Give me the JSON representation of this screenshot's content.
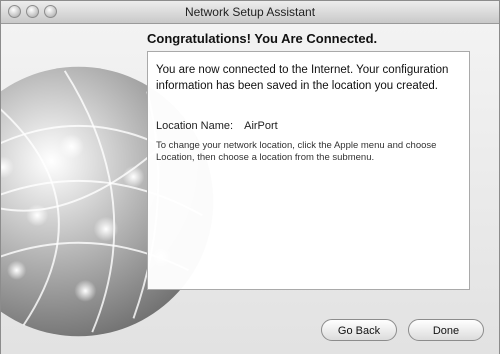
{
  "window": {
    "title": "Network Setup Assistant"
  },
  "content": {
    "heading": "Congratulations! You Are Connected.",
    "message": "You are now connected to the Internet. Your configuration information has been saved in the location you created.",
    "location_label": "Location Name:",
    "location_value": "AirPort",
    "help_text": "To change your network location, click the Apple menu and choose Location, then choose a location from the submenu."
  },
  "buttons": {
    "back": "Go Back",
    "done": "Done"
  }
}
